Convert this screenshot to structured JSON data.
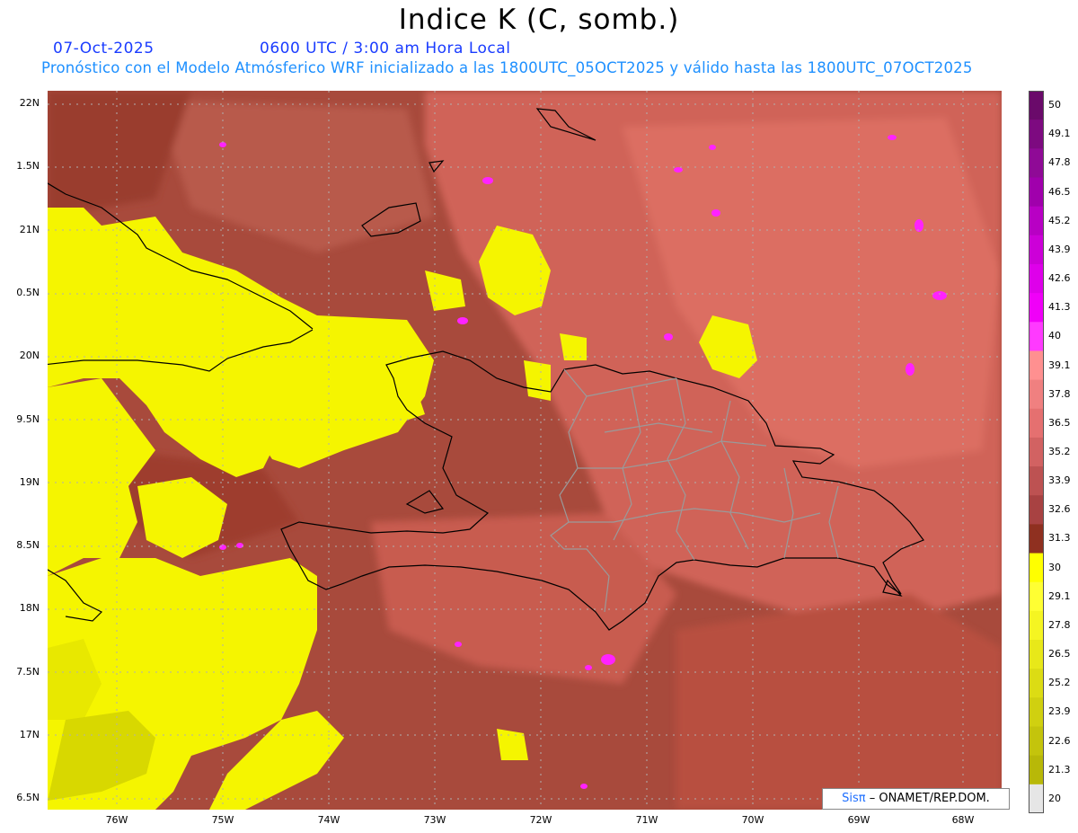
{
  "title": "Indice K (C, somb.)",
  "date_label": "07-Oct-2025",
  "time_label": "0600 UTC / 3:00 am Hora Local",
  "forecast_line": "Pronóstico con el Modelo Atmósferico WRF inicializado a las 1800UTC_05OCT2025 y válido hasta las  1800UTC_07OCT2025",
  "credit": {
    "logo": "Sisπ",
    "text": "– ONAMET/REP.DOM."
  },
  "lat_labels": [
    "22N",
    "1.5N",
    "21N",
    "0.5N",
    "20N",
    "9.5N",
    "19N",
    "8.5N",
    "18N",
    "7.5N",
    "17N",
    "6.5N"
  ],
  "lon_labels": [
    "76W",
    "75W",
    "74W",
    "73W",
    "72W",
    "71W",
    "70W",
    "69W",
    "68W"
  ],
  "colorbar": {
    "labels": [
      "50",
      "49.1",
      "47.8",
      "46.5",
      "45.2",
      "43.9",
      "42.6",
      "41.3",
      "40",
      "39.1",
      "37.8",
      "36.5",
      "35.2",
      "33.9",
      "32.6",
      "31.3",
      "30",
      "29.1",
      "27.8",
      "26.5",
      "25.2",
      "23.9",
      "22.6",
      "21.3",
      "20"
    ],
    "colors": [
      "#6a0a6a",
      "#7d0a80",
      "#8f0a96",
      "#a000ac",
      "#b800c4",
      "#cc00d8",
      "#de00ea",
      "#f000f8",
      "#ff3aff",
      "#ff9090",
      "#f08080",
      "#e57070",
      "#d26262",
      "#bd5252",
      "#a84242",
      "#8f3020",
      "#ffff00",
      "#ffff33",
      "#f5f522",
      "#e8e819",
      "#dcdc14",
      "#d0d010",
      "#c4c40c",
      "#b8b808",
      "#e6e6e6"
    ]
  },
  "legend_colors": {
    "low_yellow": "#f7f700",
    "mid_brown": "#9a4034",
    "high_pink": "#d86a64",
    "peak_magenta": "#ff22ff"
  }
}
